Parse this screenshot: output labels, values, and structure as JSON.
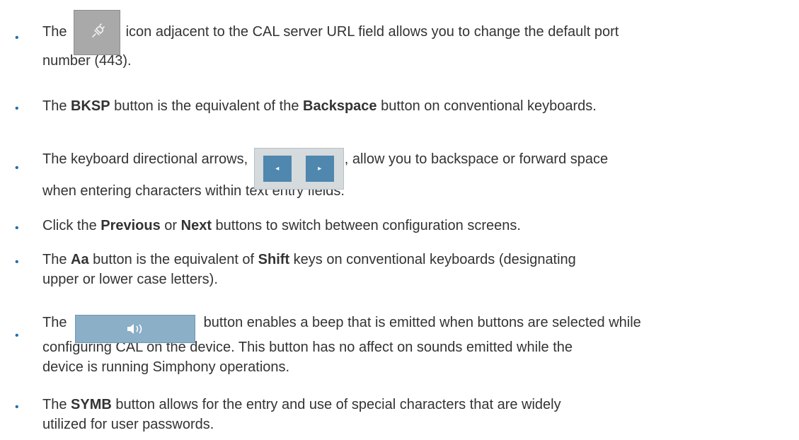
{
  "items": [
    {
      "parts": [
        {
          "t": "The "
        },
        {
          "img": "plug-icon-button"
        },
        {
          "t": " icon adjacent to the CAL server URL field allows you to change the default port"
        }
      ],
      "line2": "number (443)."
    },
    {
      "parts": [
        {
          "t": "The "
        },
        {
          "b": "BKSP"
        },
        {
          "t": " button is the equivalent of the "
        },
        {
          "b": "Backspace"
        },
        {
          "t": " button on conventional keyboards."
        }
      ]
    },
    {
      "parts": [
        {
          "t": "The keyboard directional arrows, "
        },
        {
          "img": "arrow-buttons"
        },
        {
          "t": ", allow you to backspace or forward space"
        }
      ],
      "line2": "when entering characters within text entry fields."
    },
    {
      "parts": [
        {
          "t": "Click the "
        },
        {
          "b": "Previous"
        },
        {
          "t": " or "
        },
        {
          "b": "Next"
        },
        {
          "t": " buttons to switch between configuration screens."
        }
      ]
    },
    {
      "parts": [
        {
          "t": "The "
        },
        {
          "b": "Aa"
        },
        {
          "t": " button is the equivalent of "
        },
        {
          "b": "Shift"
        },
        {
          "t": " keys on conventional keyboards (designating"
        }
      ],
      "line2": "upper or lower case letters)."
    },
    {
      "parts": [
        {
          "t": "The "
        },
        {
          "img": "sound-button"
        },
        {
          "t": " button enables a beep that is emitted when buttons are selected while"
        }
      ],
      "line2": "configuring CAL on the device. This button has no affect on sounds emitted while the",
      "line3": "device is running Simphony operations."
    },
    {
      "parts": [
        {
          "t": "The "
        },
        {
          "b": "SYMB"
        },
        {
          "t": " button allows for the entry and use of special characters that are widely"
        }
      ],
      "line2": "utilized for user passwords."
    }
  ],
  "bullet_char": "•",
  "arrow_glyphs": {
    "left": "◂",
    "right": "▸"
  },
  "colors": {
    "text": "#333333",
    "bullet": "#1f70ae",
    "button_blue": "#4f87ae",
    "sound_button": "#8aafc7",
    "plug_button": "#a9a9a9"
  }
}
